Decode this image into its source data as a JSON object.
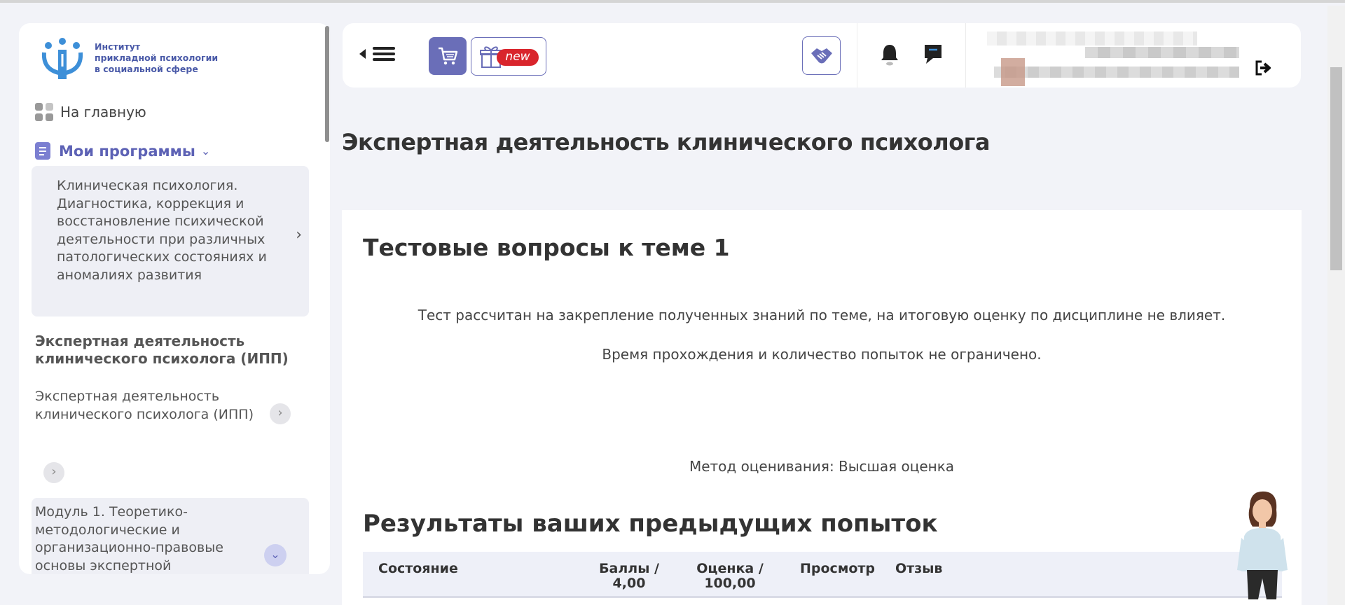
{
  "logo": {
    "line1": "Институт",
    "line2": "прикладной психологии",
    "line3": "в социальной сфере"
  },
  "sidebar": {
    "home_label": "На главную",
    "programs_label": "Мои программы",
    "program_text": "Клиническая психология. Диагностика, коррекция и восстановление психической деятельности при различных патологических состояниях и аномалиях развития",
    "course_title": "Экспертная деятельность клинического психолога (ИПП)",
    "course_link": "Экспертная деятельность клинического психолога (ИПП)",
    "module_text": "Модуль 1. Теоретико-методологические и организационно-правовые основы экспертной"
  },
  "topbar": {
    "gift_badge": "new"
  },
  "page": {
    "heading": "Экспертная деятельность клинического психолога"
  },
  "quiz": {
    "title": "Тестовые вопросы к теме 1",
    "intro1": "Тест рассчитан на закрепление полученных знаний по теме, на итоговую оценку по дисциплине не влияет.",
    "intro2": "Время прохождения и количество попыток не ограничено.",
    "grading": "Метод оценивания: Высшая оценка",
    "results_title": "Результаты ваших предыдущих попыток",
    "table": {
      "col_state": "Состояние",
      "col_points_1": "Баллы /",
      "col_points_2": "4,00",
      "col_grade_1": "Оценка /",
      "col_grade_2": "100,00",
      "col_review": "Просмотр",
      "col_feedback": "Отзыв"
    }
  },
  "colors": {
    "accent": "#5d62b5",
    "cart_bg": "#6a6eb8",
    "badge_red": "#d9252c"
  }
}
